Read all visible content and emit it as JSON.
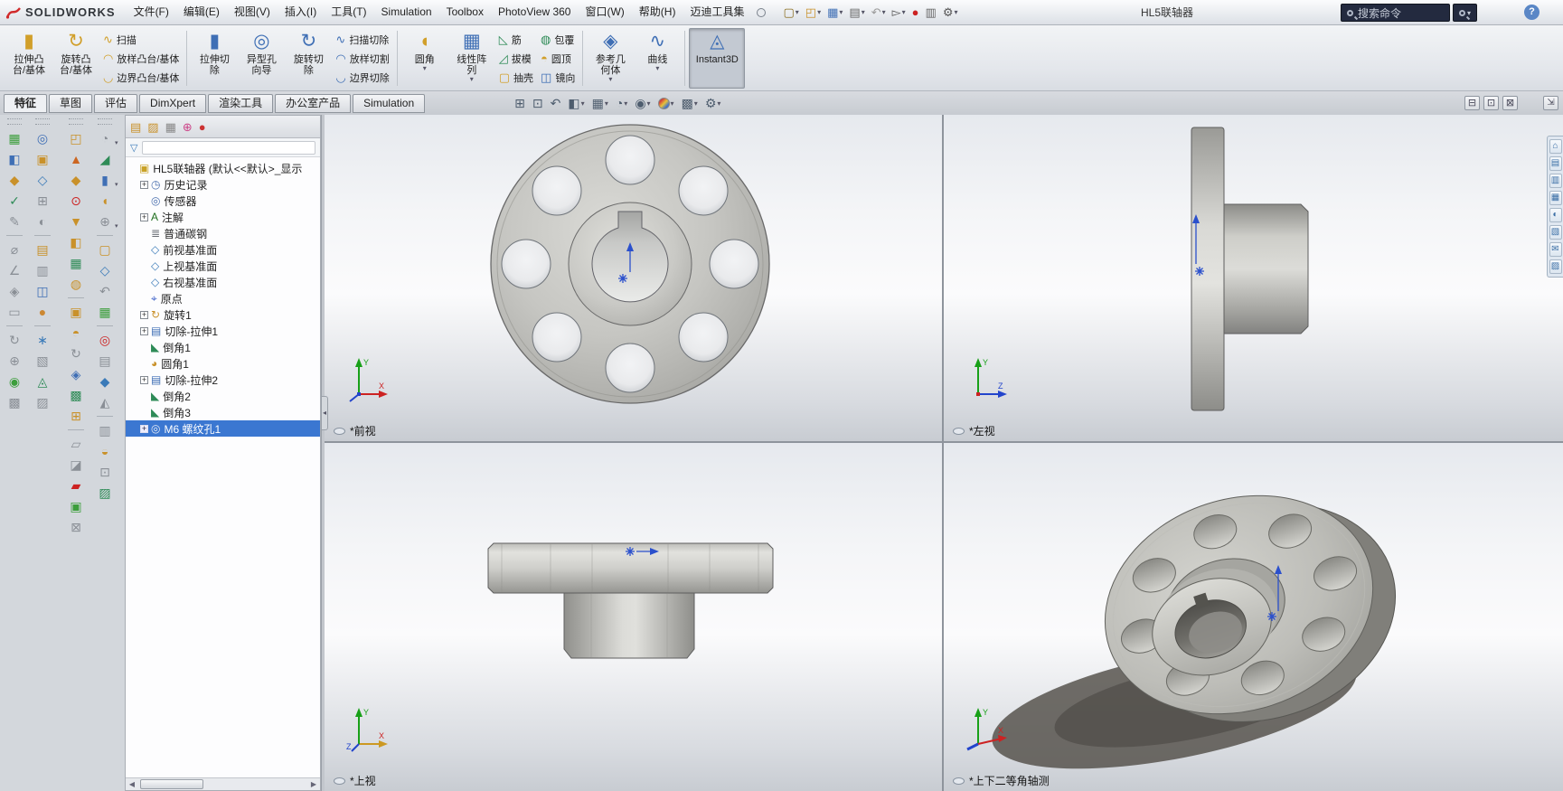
{
  "window": {
    "doc_title": "HL5联轴器",
    "search_placeholder": "搜索命令",
    "help_label": "?",
    "fullscreen_glyph": "⇲"
  },
  "logo": {
    "brand": "SOLIDWORKS"
  },
  "menubar": {
    "items": [
      "文件(F)",
      "编辑(E)",
      "视图(V)",
      "插入(I)",
      "工具(T)",
      "Simulation",
      "Toolbox",
      "PhotoView 360",
      "窗口(W)",
      "帮助(H)",
      "迈迪工具集"
    ]
  },
  "quick_access": [
    {
      "name": "new-file-button",
      "glyph": "▢",
      "color": "#8a6d1f",
      "arrow": "▾"
    },
    {
      "name": "open-file-button",
      "glyph": "◰",
      "color": "#c9912a",
      "arrow": "▾"
    },
    {
      "name": "save-button",
      "glyph": "▦",
      "color": "#3f6fb5",
      "arrow": "▾"
    },
    {
      "name": "print-button",
      "glyph": "▤",
      "color": "#666666",
      "arrow": "▾"
    },
    {
      "name": "undo-button",
      "glyph": "↶",
      "color": "#9a9a9a",
      "arrow": "▾"
    },
    {
      "name": "select-button",
      "glyph": "▻",
      "color": "#555555",
      "arrow": "▾"
    },
    {
      "name": "rebuild-button",
      "glyph": "●",
      "color": "#cc2222",
      "arrow": ""
    },
    {
      "name": "file-properties-button",
      "glyph": "▥",
      "color": "#666666",
      "arrow": ""
    },
    {
      "name": "options-button",
      "glyph": "⚙",
      "color": "#555555",
      "arrow": "▾"
    }
  ],
  "ribbon": {
    "g1big": [
      {
        "name": "extruded-boss-base-button",
        "glyph": "▮",
        "color": "#d19f2a",
        "l1": "拉伸凸",
        "l2": "台/基体",
        "arrow": "",
        "cls": ""
      },
      {
        "name": "revolved-boss-base-button",
        "glyph": "↻",
        "color": "#d19f2a",
        "l1": "旋转凸",
        "l2": "台/基体",
        "arrow": "",
        "cls": ""
      }
    ],
    "g1small": [
      {
        "name": "swept-boss-base-button",
        "glyph": "∿",
        "color": "#d19f2a",
        "label": "扫描"
      },
      {
        "name": "lofted-boss-base-button",
        "glyph": "◠",
        "color": "#d19f2a",
        "label": "放样凸台/基体"
      },
      {
        "name": "boundary-boss-base-button",
        "glyph": "◡",
        "color": "#d19f2a",
        "label": "边界凸台/基体"
      }
    ],
    "g2big": [
      {
        "name": "extruded-cut-button",
        "glyph": "▮",
        "color": "#3f6fb5",
        "l1": "拉伸切",
        "l2": "除",
        "arrow": "",
        "cls": ""
      },
      {
        "name": "hole-wizard-button",
        "glyph": "◎",
        "color": "#3f6fb5",
        "l1": "异型孔",
        "l2": "向导",
        "arrow": "",
        "cls": ""
      },
      {
        "name": "revolved-cut-button",
        "glyph": "↻",
        "color": "#3f6fb5",
        "l1": "旋转切",
        "l2": "除",
        "arrow": "",
        "cls": ""
      }
    ],
    "g2small": [
      {
        "name": "swept-cut-button",
        "glyph": "∿",
        "color": "#3f6fb5",
        "label": "扫描切除"
      },
      {
        "name": "lofted-cut-button",
        "glyph": "◠",
        "color": "#3f6fb5",
        "label": "放样切割"
      },
      {
        "name": "boundary-cut-button",
        "glyph": "◡",
        "color": "#3f6fb5",
        "label": "边界切除"
      }
    ],
    "g3big": [
      {
        "name": "fillet-button",
        "glyph": "◖",
        "color": "#d19f2a",
        "l1": "圆角",
        "l2": "",
        "arrow": "▾",
        "cls": ""
      },
      {
        "name": "linear-pattern-button",
        "glyph": "▦",
        "color": "#3f6fb5",
        "l1": "线性阵",
        "l2": "列",
        "arrow": "▾",
        "cls": ""
      }
    ],
    "g3small1": [
      {
        "name": "rib-button",
        "glyph": "◺",
        "color": "#2e8b57",
        "label": "筋"
      },
      {
        "name": "draft-button",
        "glyph": "◿",
        "color": "#2e8b57",
        "label": "拔模"
      },
      {
        "name": "shell-button",
        "glyph": "▢",
        "color": "#d19f2a",
        "label": "抽壳"
      }
    ],
    "g3small2": [
      {
        "name": "wrap-button",
        "glyph": "◍",
        "color": "#2e8b57",
        "label": "包覆"
      },
      {
        "name": "dome-button",
        "glyph": "◓",
        "color": "#d19f2a",
        "label": "圆顶"
      },
      {
        "name": "mirror-button",
        "glyph": "◫",
        "color": "#3f6fb5",
        "label": "镜向"
      }
    ],
    "g4big": [
      {
        "name": "reference-geometry-button",
        "glyph": "◈",
        "color": "#3f6fb5",
        "l1": "参考几",
        "l2": "何体",
        "arrow": "▾",
        "cls": ""
      },
      {
        "name": "curves-button",
        "glyph": "∿",
        "color": "#3f6fb5",
        "l1": "曲线",
        "l2": "",
        "arrow": "▾",
        "cls": ""
      }
    ],
    "g5big": [
      {
        "name": "instant3d-button",
        "glyph": "◬",
        "color": "#3f6fb5",
        "l1": "Instant3D",
        "l2": "",
        "arrow": "",
        "cls": "pressed"
      }
    ]
  },
  "tabs": [
    {
      "label": "特征",
      "cls": "active"
    },
    {
      "label": "草图",
      "cls": ""
    },
    {
      "label": "评估",
      "cls": ""
    },
    {
      "label": "DimXpert",
      "cls": ""
    },
    {
      "label": "渲染工具",
      "cls": ""
    },
    {
      "label": "办公室产品",
      "cls": ""
    },
    {
      "label": "Simulation",
      "cls": ""
    }
  ],
  "headsup": [
    {
      "name": "zoom-to-fit-button",
      "glyph": "⊞",
      "cls": "",
      "arrow": ""
    },
    {
      "name": "zoom-to-area-button",
      "glyph": "⊡",
      "cls": "",
      "arrow": ""
    },
    {
      "name": "previous-view-button",
      "glyph": "↶",
      "cls": "",
      "arrow": ""
    },
    {
      "name": "section-view-button",
      "glyph": "◧",
      "cls": "",
      "arrow": "▾"
    },
    {
      "name": "view-orientation-button",
      "glyph": "▦",
      "cls": "",
      "arrow": "▾"
    },
    {
      "name": "display-style-button",
      "glyph": "◔",
      "cls": "",
      "arrow": "▾"
    },
    {
      "name": "hide-show-items-button",
      "glyph": "◉",
      "cls": "",
      "arrow": "▾"
    },
    {
      "name": "edit-appearance-button",
      "glyph": "",
      "cls": "ball",
      "arrow": "▾"
    },
    {
      "name": "apply-scene-button",
      "glyph": "▩",
      "cls": "",
      "arrow": "▾"
    },
    {
      "name": "view-settings-button",
      "glyph": "⚙",
      "cls": "",
      "arrow": "▾"
    }
  ],
  "window_controls": [
    {
      "name": "viewport-minimize-button",
      "glyph": "⊟"
    },
    {
      "name": "viewport-restore-button",
      "glyph": "⊡"
    },
    {
      "name": "viewport-close-button",
      "glyph": "⊠"
    }
  ],
  "left_toolbars": {
    "s1": [
      {
        "glyph": "▦",
        "color": "#3c9e3c",
        "cls": "",
        "arrow": ""
      },
      {
        "glyph": "◧",
        "color": "#3f6fb5",
        "cls": "",
        "arrow": ""
      },
      {
        "glyph": "◆",
        "color": "#c9912a",
        "cls": "",
        "arrow": ""
      },
      {
        "glyph": "✓",
        "color": "#2e8b57",
        "cls": "",
        "arrow": ""
      },
      {
        "glyph": "✎",
        "color": "#8a8f96",
        "cls": "",
        "arrow": ""
      },
      {
        "cls": "sep"
      },
      {
        "glyph": "⌀",
        "color": "#8a8f96",
        "cls": "",
        "arrow": ""
      },
      {
        "glyph": "∠",
        "color": "#8a8f96",
        "cls": "",
        "arrow": ""
      },
      {
        "glyph": "◈",
        "color": "#8a8f96",
        "cls": "",
        "arrow": ""
      },
      {
        "glyph": "▭",
        "color": "#8a8f96",
        "cls": "",
        "arrow": ""
      },
      {
        "cls": "sep"
      },
      {
        "glyph": "↻",
        "color": "#8a8f96",
        "cls": "",
        "arrow": ""
      },
      {
        "glyph": "⊕",
        "color": "#8a8f96",
        "cls": "",
        "arrow": ""
      },
      {
        "glyph": "◉",
        "color": "#3c9e3c",
        "cls": "",
        "arrow": ""
      },
      {
        "glyph": "▩",
        "color": "#8a8f96",
        "cls": "",
        "arrow": ""
      }
    ],
    "s2": [
      {
        "glyph": "◎",
        "color": "#3f6fb5",
        "cls": "",
        "arrow": ""
      },
      {
        "glyph": "▣",
        "color": "#c9912a",
        "cls": "",
        "arrow": ""
      },
      {
        "glyph": "◇",
        "color": "#3a7ab8",
        "cls": "",
        "arrow": ""
      },
      {
        "glyph": "⊞",
        "color": "#8a8f96",
        "cls": "",
        "arrow": ""
      },
      {
        "glyph": "◐",
        "color": "#8a8f96",
        "cls": "",
        "arrow": ""
      },
      {
        "cls": "sep"
      },
      {
        "glyph": "▤",
        "color": "#c9912a",
        "cls": "",
        "arrow": ""
      },
      {
        "glyph": "▥",
        "color": "#8a8f96",
        "cls": "",
        "arrow": ""
      },
      {
        "glyph": "◫",
        "color": "#3f6fb5",
        "cls": "",
        "arrow": ""
      },
      {
        "glyph": "●",
        "color": "#cc8833",
        "cls": "",
        "arrow": ""
      },
      {
        "cls": "sep"
      },
      {
        "glyph": "∗",
        "color": "#3a7ab8",
        "cls": "",
        "arrow": ""
      },
      {
        "glyph": "▧",
        "color": "#8a8f96",
        "cls": "",
        "arrow": ""
      },
      {
        "glyph": "◬",
        "color": "#2e8b57",
        "cls": "",
        "arrow": ""
      },
      {
        "glyph": "▨",
        "color": "#8a8f96",
        "cls": "",
        "arrow": ""
      }
    ],
    "s3": [
      {
        "glyph": "◰",
        "color": "#c9912a",
        "cls": "",
        "arrow": ""
      },
      {
        "glyph": "▲",
        "color": "#cc6622",
        "cls": "",
        "arrow": ""
      },
      {
        "glyph": "◆",
        "color": "#c9912a",
        "cls": "",
        "arrow": ""
      },
      {
        "glyph": "⊙",
        "color": "#cc2222",
        "cls": "",
        "arrow": ""
      },
      {
        "glyph": "▼",
        "color": "#c9912a",
        "cls": "",
        "arrow": ""
      },
      {
        "glyph": "◧",
        "color": "#c9912a",
        "cls": "",
        "arrow": ""
      },
      {
        "glyph": "▦",
        "color": "#2e8b57",
        "cls": "",
        "arrow": ""
      },
      {
        "glyph": "◍",
        "color": "#c9912a",
        "cls": "",
        "arrow": ""
      },
      {
        "cls": "sep"
      },
      {
        "glyph": "▣",
        "color": "#c9912a",
        "cls": "",
        "arrow": ""
      },
      {
        "glyph": "◓",
        "color": "#c9912a",
        "cls": "",
        "arrow": ""
      },
      {
        "glyph": "↻",
        "color": "#8a8f96",
        "cls": "",
        "arrow": ""
      },
      {
        "glyph": "◈",
        "color": "#3f6fb5",
        "cls": "",
        "arrow": ""
      },
      {
        "glyph": "▩",
        "color": "#2e8b57",
        "cls": "",
        "arrow": ""
      },
      {
        "glyph": "⊞",
        "color": "#c9912a",
        "cls": "",
        "arrow": ""
      },
      {
        "cls": "sep"
      },
      {
        "glyph": "▱",
        "color": "#8a8f96",
        "cls": "",
        "arrow": ""
      },
      {
        "glyph": "◪",
        "color": "#8a8f96",
        "cls": "",
        "arrow": ""
      },
      {
        "glyph": "▰",
        "color": "#cc2222",
        "cls": "",
        "arrow": ""
      },
      {
        "glyph": "▣",
        "color": "#3c9e3c",
        "cls": "",
        "arrow": ""
      },
      {
        "glyph": "⊠",
        "color": "#8a8f96",
        "cls": "",
        "arrow": ""
      }
    ],
    "s4": [
      {
        "glyph": "◔",
        "color": "#8a8f96",
        "cls": "",
        "arrow": "▾"
      },
      {
        "glyph": "◢",
        "color": "#2e8b57",
        "cls": "",
        "arrow": ""
      },
      {
        "glyph": "▮",
        "color": "#3f6fb5",
        "cls": "",
        "arrow": "▾"
      },
      {
        "glyph": "◖",
        "color": "#c9912a",
        "cls": "",
        "arrow": ""
      },
      {
        "glyph": "⊕",
        "color": "#8a8f96",
        "cls": "",
        "arrow": "▾"
      },
      {
        "cls": "sep"
      },
      {
        "glyph": "▢",
        "color": "#c9912a",
        "cls": "",
        "arrow": ""
      },
      {
        "glyph": "◇",
        "color": "#3a7ab8",
        "cls": "",
        "arrow": ""
      },
      {
        "glyph": "↶",
        "color": "#8a8f96",
        "cls": "",
        "arrow": ""
      },
      {
        "glyph": "▦",
        "color": "#3c9e3c",
        "cls": "",
        "arrow": ""
      },
      {
        "cls": "sep"
      },
      {
        "glyph": "◎",
        "color": "#cc2222",
        "cls": "",
        "arrow": ""
      },
      {
        "glyph": "▤",
        "color": "#8a8f96",
        "cls": "",
        "arrow": ""
      },
      {
        "glyph": "◆",
        "color": "#3a7ab8",
        "cls": "",
        "arrow": ""
      },
      {
        "glyph": "◭",
        "color": "#8a8f96",
        "cls": "",
        "arrow": ""
      },
      {
        "cls": "sep"
      },
      {
        "glyph": "▥",
        "color": "#8a8f96",
        "cls": "",
        "arrow": ""
      },
      {
        "glyph": "◒",
        "color": "#c9912a",
        "cls": "",
        "arrow": ""
      },
      {
        "glyph": "⊡",
        "color": "#8a8f96",
        "cls": "",
        "arrow": ""
      },
      {
        "glyph": "▨",
        "color": "#2e8b57",
        "cls": "",
        "arrow": ""
      }
    ]
  },
  "feature_tree": {
    "manager_tabs": [
      {
        "name": "featuremanager-tab",
        "glyph": "▤",
        "color": "#c9912a"
      },
      {
        "name": "propertymanager-tab",
        "glyph": "▨",
        "color": "#c9912a"
      },
      {
        "name": "configurationmanager-tab",
        "glyph": "▦",
        "color": "#888888"
      },
      {
        "name": "dimxpertmanager-tab",
        "glyph": "⊕",
        "color": "#cc4488"
      },
      {
        "name": "displaymanager-tab",
        "glyph": "●",
        "color": "#cc3333"
      }
    ],
    "overflow": "»",
    "filter_glyph": "▽",
    "items": [
      {
        "expand": "",
        "icon": "part-icon",
        "glyph": "▣",
        "color": "#c9a227",
        "label": "HL5联轴器 (默认<<默认>_显示",
        "cls": "root"
      },
      {
        "expand": "+",
        "icon": "history-folder-icon",
        "glyph": "◷",
        "color": "#4a6fae",
        "label": "历史记录",
        "cls": ""
      },
      {
        "expand": "",
        "icon": "sensors-folder-icon",
        "glyph": "◎",
        "color": "#4a6fae",
        "label": "传感器",
        "cls": ""
      },
      {
        "expand": "+",
        "icon": "annotations-folder-icon",
        "glyph": "A",
        "color": "#1f6e1f",
        "label": "注解",
        "cls": ""
      },
      {
        "expand": "",
        "icon": "material-icon",
        "glyph": "≣",
        "color": "#6b6f76",
        "label": "普通碳钢",
        "cls": ""
      },
      {
        "expand": "",
        "icon": "front-plane-icon",
        "glyph": "◇",
        "color": "#3a7ab8",
        "label": "前视基准面",
        "cls": ""
      },
      {
        "expand": "",
        "icon": "top-plane-icon",
        "glyph": "◇",
        "color": "#3a7ab8",
        "label": "上视基准面",
        "cls": ""
      },
      {
        "expand": "",
        "icon": "right-plane-icon",
        "glyph": "◇",
        "color": "#3a7ab8",
        "label": "右视基准面",
        "cls": ""
      },
      {
        "expand": "",
        "icon": "origin-icon",
        "glyph": "⌖",
        "color": "#3a5fc8",
        "label": "原点",
        "cls": ""
      },
      {
        "expand": "+",
        "icon": "revolve-feature-icon",
        "glyph": "↻",
        "color": "#c9912a",
        "label": "旋转1",
        "cls": ""
      },
      {
        "expand": "+",
        "icon": "cut-extrude-feature-icon",
        "glyph": "▤",
        "color": "#3f6fb5",
        "label": "切除-拉伸1",
        "cls": ""
      },
      {
        "expand": "",
        "icon": "chamfer-feature-icon",
        "glyph": "◣",
        "color": "#2e8b57",
        "label": "倒角1",
        "cls": ""
      },
      {
        "expand": "",
        "icon": "fillet-feature-icon",
        "glyph": "◕",
        "color": "#c9912a",
        "label": "圆角1",
        "cls": ""
      },
      {
        "expand": "+",
        "icon": "cut-extrude-feature-icon",
        "glyph": "▤",
        "color": "#3f6fb5",
        "label": "切除-拉伸2",
        "cls": ""
      },
      {
        "expand": "",
        "icon": "chamfer-feature-icon",
        "glyph": "◣",
        "color": "#2e8b57",
        "label": "倒角2",
        "cls": ""
      },
      {
        "expand": "",
        "icon": "chamfer-feature-icon",
        "glyph": "◣",
        "color": "#2e8b57",
        "label": "倒角3",
        "cls": ""
      },
      {
        "expand": "+",
        "icon": "hole-wizard-feature-icon",
        "glyph": "◎",
        "color": "#e8ecf5",
        "label": "M6 螺纹孔1",
        "cls": "selected"
      }
    ],
    "scroll_left": "◀",
    "scroll_right": "▶",
    "splitter_glyph": "◂"
  },
  "viewports": [
    {
      "name": "front-view",
      "label": "*前视"
    },
    {
      "name": "left-view",
      "label": "*左视"
    },
    {
      "name": "top-view",
      "label": "*上视"
    },
    {
      "name": "isometric-view",
      "label": "*上下二等角轴测"
    }
  ],
  "task_pane": [
    {
      "name": "solidworks-resources-tab",
      "glyph": "⌂"
    },
    {
      "name": "design-library-tab",
      "glyph": "▤"
    },
    {
      "name": "file-explorer-tab",
      "glyph": "▥"
    },
    {
      "name": "view-palette-tab",
      "glyph": "▦"
    },
    {
      "name": "appearances-tab",
      "glyph": "◐"
    },
    {
      "name": "custom-properties-tab",
      "glyph": "▧"
    },
    {
      "name": "forum-tab",
      "glyph": "✉"
    },
    {
      "name": "documents-tab",
      "glyph": "▨"
    }
  ],
  "colors": {
    "selection": "#3b77d1",
    "metal": "#b8b6b1",
    "annotation_blue": "#2b50cc",
    "shadow": "#57534e"
  }
}
